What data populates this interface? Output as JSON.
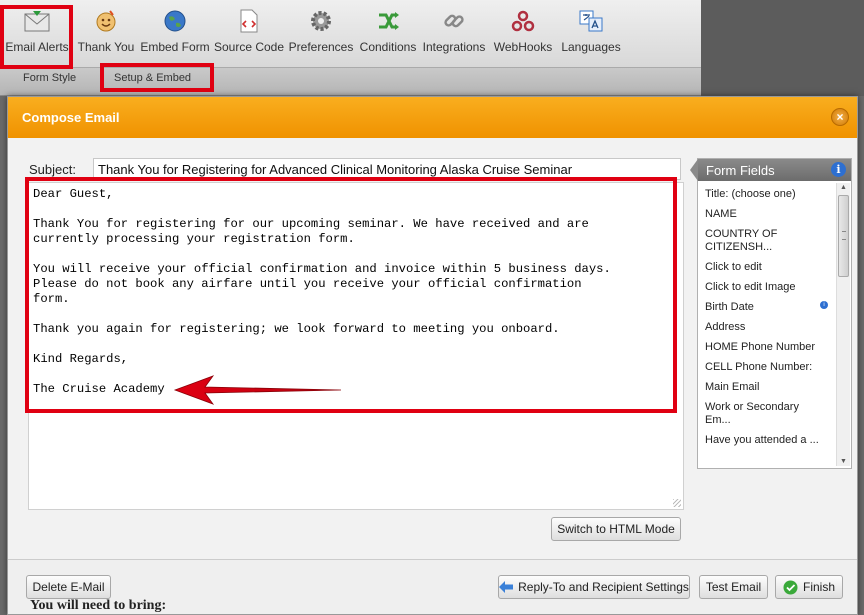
{
  "toolbar": {
    "items": [
      {
        "label": "Email Alerts",
        "icon": "envelope-icon"
      },
      {
        "label": "Thank You",
        "icon": "thank-you-icon"
      },
      {
        "label": "Embed Form",
        "icon": "globe-icon"
      },
      {
        "label": "Source Code",
        "icon": "source-code-icon"
      },
      {
        "label": "Preferences",
        "icon": "gear-icon"
      },
      {
        "label": "Conditions",
        "icon": "conditions-icon"
      },
      {
        "label": "Integrations",
        "icon": "chain-link-icon"
      },
      {
        "label": "WebHooks",
        "icon": "webhooks-icon"
      },
      {
        "label": "Languages",
        "icon": "languages-icon"
      }
    ]
  },
  "subnav": {
    "form_style": "Form Style",
    "setup_embed": "Setup & Embed"
  },
  "modal": {
    "title": "Compose Email",
    "close": "×",
    "subject_label": "Subject:",
    "subject_value": "Thank You for Registering for Advanced Clinical Monitoring Alaska Cruise Seminar",
    "body": "Dear Guest,\n\nThank You for registering for our upcoming seminar. We have received and are\ncurrently processing your registration form.\n\nYou will receive your official confirmation and invoice within 5 business days.\nPlease do not book any airfare until you receive your official confirmation\nform.\n\nThank you again for registering; we look forward to meeting you onboard.\n\nKind Regards,\n\nThe Cruise Academy",
    "html_mode_button": "Switch to HTML Mode"
  },
  "form_fields": {
    "title": "Form Fields",
    "info": "i",
    "items": [
      "Title: (choose one)",
      "NAME",
      "COUNTRY OF CITIZENSH...",
      "Click to edit",
      "Click to edit Image",
      "Birth Date",
      "Address",
      "HOME Phone Number",
      "CELL Phone Number:",
      "Main Email",
      "Work or Secondary Em...",
      "Have you attended a ..."
    ]
  },
  "footer": {
    "delete": "Delete E-Mail",
    "reply_to": "Reply-To and Recipient Settings",
    "test": "Test Email",
    "finish": "Finish"
  },
  "background": {
    "partial_text": "You will need to bring:"
  },
  "colors": {
    "accent_orange": "#f09200",
    "highlight_red": "#e00012"
  }
}
